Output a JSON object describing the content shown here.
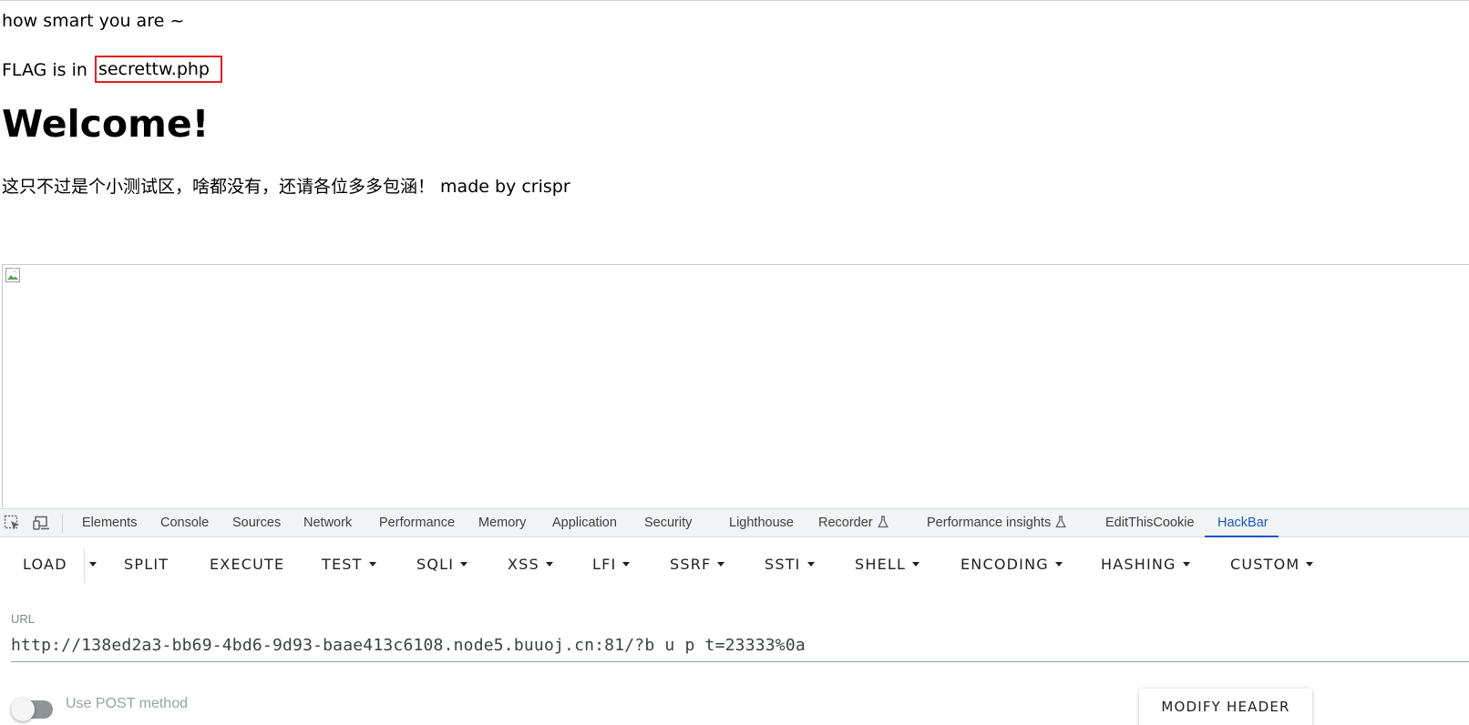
{
  "page": {
    "line1": "how smart you are ~",
    "flag_prefix": "FLAG is in ",
    "flag_file": "secrettw.php",
    "heading": "Welcome!",
    "description": "这只不过是个小测试区，啥都没有，还请各位多多包涵！ made by crispr",
    "highlight_color": "#e01e1e"
  },
  "devtools": {
    "icons": [
      "inspect-element-icon",
      "device-toolbar-icon"
    ],
    "tabs": [
      {
        "label": "Elements"
      },
      {
        "label": "Console"
      },
      {
        "label": "Sources"
      },
      {
        "label": "Network"
      },
      {
        "label": "Performance"
      },
      {
        "label": "Memory"
      },
      {
        "label": "Application"
      },
      {
        "label": "Security"
      },
      {
        "label": "Lighthouse"
      },
      {
        "label": "Recorder"
      },
      {
        "label": "Performance insights"
      },
      {
        "label": "EditThisCookie"
      },
      {
        "label": "HackBar",
        "active": true
      }
    ],
    "accent_color": "#1a57c9"
  },
  "hackbar": {
    "buttons": {
      "load": "LOAD",
      "split": "SPLIT",
      "execute": "EXECUTE",
      "test": "TEST",
      "sqli": "SQLI",
      "xss": "XSS",
      "lfi": "LFI",
      "ssrf": "SSRF",
      "ssti": "SSTI",
      "shell": "SHELL",
      "encoding": "ENCODING",
      "hashing": "HASHING",
      "custom": "CUSTOM"
    },
    "url_label": "URL",
    "url_value": "http://138ed2a3-bb69-4bd6-9d93-baae413c6108.node5.buuoj.cn:81/?b u p t=23333%0a",
    "post_label": "Use POST method",
    "modify_header": "MODIFY HEADER"
  }
}
